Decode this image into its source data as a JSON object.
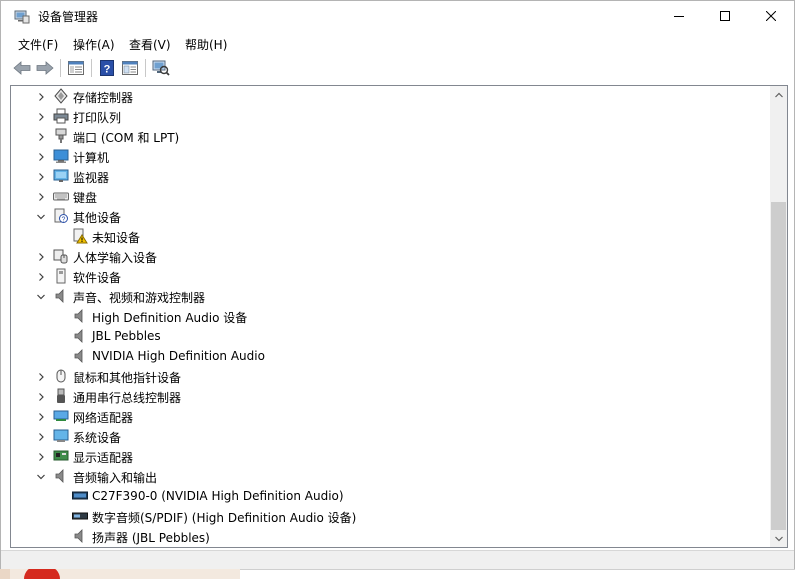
{
  "window": {
    "title": "设备管理器",
    "controls": {
      "minimize_icon": "minimize-icon",
      "maximize_icon": "maximize-icon",
      "close_icon": "close-icon"
    }
  },
  "menu": [
    "文件(F)",
    "操作(A)",
    "查看(V)",
    "帮助(H)"
  ],
  "toolbar": {
    "buttons": [
      "back-arrow-icon",
      "forward-arrow-icon",
      "properties-icon",
      "help-icon",
      "show-hide-console-tree-icon",
      "scan-hardware-icon"
    ]
  },
  "tree": [
    {
      "label": "存储控制器",
      "expanded": false,
      "level": 0,
      "icon": "storage-controller-icon"
    },
    {
      "label": "打印队列",
      "expanded": false,
      "level": 0,
      "icon": "printer-icon"
    },
    {
      "label": "端口 (COM 和 LPT)",
      "expanded": false,
      "level": 0,
      "icon": "port-icon"
    },
    {
      "label": "计算机",
      "expanded": false,
      "level": 0,
      "icon": "computer-icon"
    },
    {
      "label": "监视器",
      "expanded": false,
      "level": 0,
      "icon": "monitor-icon"
    },
    {
      "label": "键盘",
      "expanded": false,
      "level": 0,
      "icon": "keyboard-icon"
    },
    {
      "label": "其他设备",
      "expanded": true,
      "level": 0,
      "icon": "other-devices-icon"
    },
    {
      "label": "未知设备",
      "level": 1,
      "icon": "unknown-device-warning-icon"
    },
    {
      "label": "人体学输入设备",
      "expanded": false,
      "level": 0,
      "icon": "hid-icon"
    },
    {
      "label": "软件设备",
      "expanded": false,
      "level": 0,
      "icon": "software-device-icon"
    },
    {
      "label": "声音、视频和游戏控制器",
      "expanded": true,
      "level": 0,
      "icon": "speaker-icon"
    },
    {
      "label": "High Definition Audio 设备",
      "level": 1,
      "icon": "speaker-icon"
    },
    {
      "label": "JBL Pebbles",
      "level": 1,
      "icon": "speaker-icon"
    },
    {
      "label": "NVIDIA High Definition Audio",
      "level": 1,
      "icon": "speaker-icon"
    },
    {
      "label": "鼠标和其他指针设备",
      "expanded": false,
      "level": 0,
      "icon": "mouse-icon"
    },
    {
      "label": "通用串行总线控制器",
      "expanded": false,
      "level": 0,
      "icon": "usb-icon"
    },
    {
      "label": "网络适配器",
      "expanded": false,
      "level": 0,
      "icon": "network-adapter-icon"
    },
    {
      "label": "系统设备",
      "expanded": false,
      "level": 0,
      "icon": "system-device-icon"
    },
    {
      "label": "显示适配器",
      "expanded": false,
      "level": 0,
      "icon": "display-adapter-icon"
    },
    {
      "label": "音频输入和输出",
      "expanded": true,
      "level": 0,
      "icon": "speaker-icon"
    },
    {
      "label": "C27F390-0 (NVIDIA High Definition Audio)",
      "level": 1,
      "icon": "display-audio-icon"
    },
    {
      "label": "数字音频(S/PDIF) (High Definition Audio 设备)",
      "level": 1,
      "icon": "spdif-icon"
    },
    {
      "label": "扬声器 (JBL Pebbles)",
      "level": 1,
      "icon": "speaker-icon"
    }
  ],
  "colors": {
    "window_bg": "#ffffff",
    "border": "#828790",
    "scroll_thumb": "#cdcdcd"
  }
}
